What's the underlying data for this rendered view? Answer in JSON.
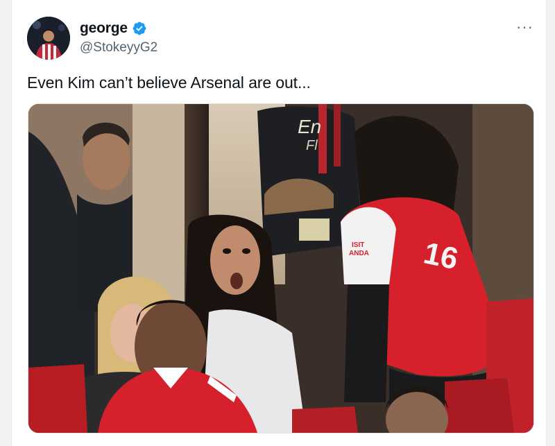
{
  "tweet": {
    "author": {
      "display_name": "george",
      "handle": "@StokeyyG2",
      "verified": true,
      "avatar_icon": "avatar-photo",
      "verified_icon": "verified-badge-icon"
    },
    "more_label": "···",
    "text": "Even Kim can’t believe Arsenal are out...",
    "media": {
      "type": "photo",
      "shirt_text": {
        "left_sponsor": "En",
        "left_sponsor_line2": "Fl",
        "sleeve_line1": "ISIT",
        "sleeve_line2": "ANDA",
        "number": "16"
      }
    }
  },
  "colors": {
    "verified_blue": "#1d9bf0",
    "handle_gray": "#536471",
    "arsenal_red": "#d6202b"
  }
}
